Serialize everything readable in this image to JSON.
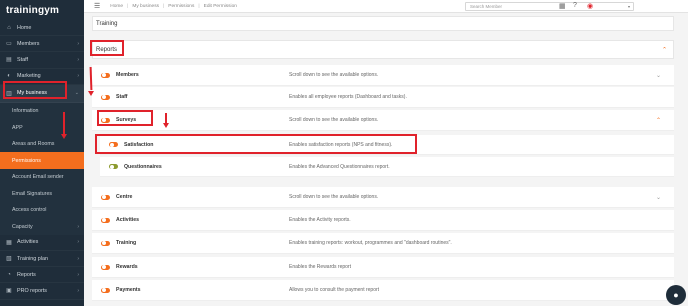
{
  "app": {
    "logo": "trainingym"
  },
  "sidebar": {
    "items": [
      {
        "label": "Home",
        "icon": "home-icon",
        "glyph": "⌂"
      },
      {
        "label": "Members",
        "icon": "members-icon",
        "glyph": "▭",
        "chevron": "›"
      },
      {
        "label": "Staff",
        "icon": "staff-icon",
        "glyph": "▤",
        "chevron": "›"
      },
      {
        "label": "Marketing",
        "icon": "marketing-icon",
        "glyph": "◐",
        "chevron": "›"
      },
      {
        "label": "My business",
        "icon": "briefcase-icon",
        "glyph": "▥",
        "chevron": "⌄"
      }
    ],
    "subitems": [
      {
        "label": "Information"
      },
      {
        "label": "APP"
      },
      {
        "label": "Areas and Rooms"
      },
      {
        "label": "Permissions",
        "selected": true
      },
      {
        "label": "Account Email sender"
      },
      {
        "label": "Email Signatures"
      },
      {
        "label": "Access control"
      },
      {
        "label": "Capacity",
        "chevron": "›"
      }
    ],
    "bottom": [
      {
        "label": "Activities",
        "icon": "activities-icon",
        "glyph": "▦",
        "chevron": "›"
      },
      {
        "label": "Training plan",
        "icon": "training-plan-icon",
        "glyph": "▧",
        "chevron": "›"
      },
      {
        "label": "Reports",
        "icon": "reports-icon",
        "glyph": "◔",
        "chevron": "›"
      },
      {
        "label": "PRO reports",
        "icon": "pro-reports-icon",
        "glyph": "▣",
        "chevron": "›"
      }
    ]
  },
  "topbar": {
    "breadcrumb": [
      "Home",
      "My business",
      "Permissions",
      "Edit Permission"
    ],
    "search_placeholder": "Search Member"
  },
  "panels": {
    "training": "Training",
    "reports": "Reports"
  },
  "rows": [
    {
      "label": "Members",
      "desc": "Scroll down to see the available options.",
      "chevron": "⌄"
    },
    {
      "label": "Staff",
      "desc": "Enables all employee reports (Dashboard and tasks)."
    },
    {
      "label": "Surveys",
      "desc": "Scroll down to see the available options.",
      "chevron": "⌃"
    },
    {
      "label": "Satisfaction",
      "desc": "Enables satisfaction reports (NPS and fitness).",
      "sub": true
    },
    {
      "label": "Questionnaires",
      "desc": "Enables the Advanced Questionnaires report.",
      "sub": true,
      "olive": true
    },
    {
      "label": "Centre",
      "desc": "Scroll down to see the available options.",
      "chevron": "⌄"
    },
    {
      "label": "Activities",
      "desc": "Enables the Activity reports."
    },
    {
      "label": "Training",
      "desc": "Enables training reports: workout, programmes and \"dashboard routines\"."
    },
    {
      "label": "Rewards",
      "desc": "Enables the Rewards report"
    },
    {
      "label": "Payments",
      "desc": "Allows you to consult the payment report"
    }
  ],
  "colors": {
    "accent": "#f46e1e",
    "sidebar": "#1f2d3a",
    "annotation": "#e0222b"
  }
}
